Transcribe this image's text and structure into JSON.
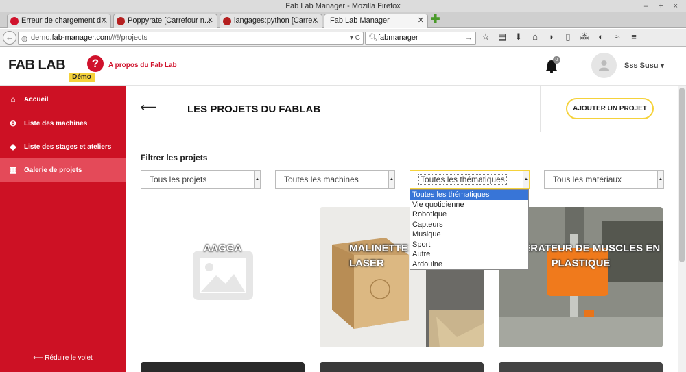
{
  "window": {
    "title": "Fab Lab Manager - Mozilla Firefox",
    "controls": "– + ×"
  },
  "tabs": [
    {
      "label": "Erreur de chargement d...",
      "icon": "error-icon"
    },
    {
      "label": "Poppyrate [Carrefour n...",
      "icon": "carrefour-icon"
    },
    {
      "label": "langages:python [Carre...",
      "icon": "carrefour-icon"
    },
    {
      "label": "Fab Lab Manager",
      "icon": "fablab-icon"
    }
  ],
  "navbar": {
    "url_prefix": "demo.",
    "url_domain": "fab-manager.com",
    "url_path": "/#!/projects",
    "search_value": "fabmanager"
  },
  "header": {
    "logo": "FAB LAB",
    "demo_badge": "Démo",
    "about_link": "A propos du Fab Lab",
    "notifications_count": "0",
    "username": "Sss Susu ▾"
  },
  "sidebar": {
    "items": [
      {
        "label": "Accueil",
        "icon": "home-icon"
      },
      {
        "label": "Liste des machines",
        "icon": "gears-icon"
      },
      {
        "label": "Liste des stages et ateliers",
        "icon": "tags-icon"
      },
      {
        "label": "Galerie de projets",
        "icon": "grid-icon"
      }
    ],
    "reduce_label": "⟵ Réduire le volet"
  },
  "page": {
    "title": "LES PROJETS DU FABLAB",
    "add_button": "AJOUTER UN PROJET",
    "filter_label": "Filtrer les projets"
  },
  "filters": [
    {
      "value": "Tous les projets"
    },
    {
      "value": "Toutes les machines"
    },
    {
      "value": "Toutes les thématiques"
    },
    {
      "value": "Tous les matériaux"
    }
  ],
  "dropdown": {
    "options": [
      "Toutes les thématiques",
      "Vie quotidienne",
      "Robotique",
      "Capteurs",
      "Musique",
      "Sport",
      "Autre",
      "Ardouine"
    ],
    "selected_index": 0
  },
  "projects": [
    {
      "title": "AAGGA"
    },
    {
      "title": "MALINETTE LASER"
    },
    {
      "title": "GÉNÉRATEUR DE MUSCLES EN PLASTIQUE"
    }
  ],
  "colors": {
    "brand_red": "#cd1124",
    "accent_yellow": "#f5d23b",
    "active_item": "#e44a59"
  }
}
